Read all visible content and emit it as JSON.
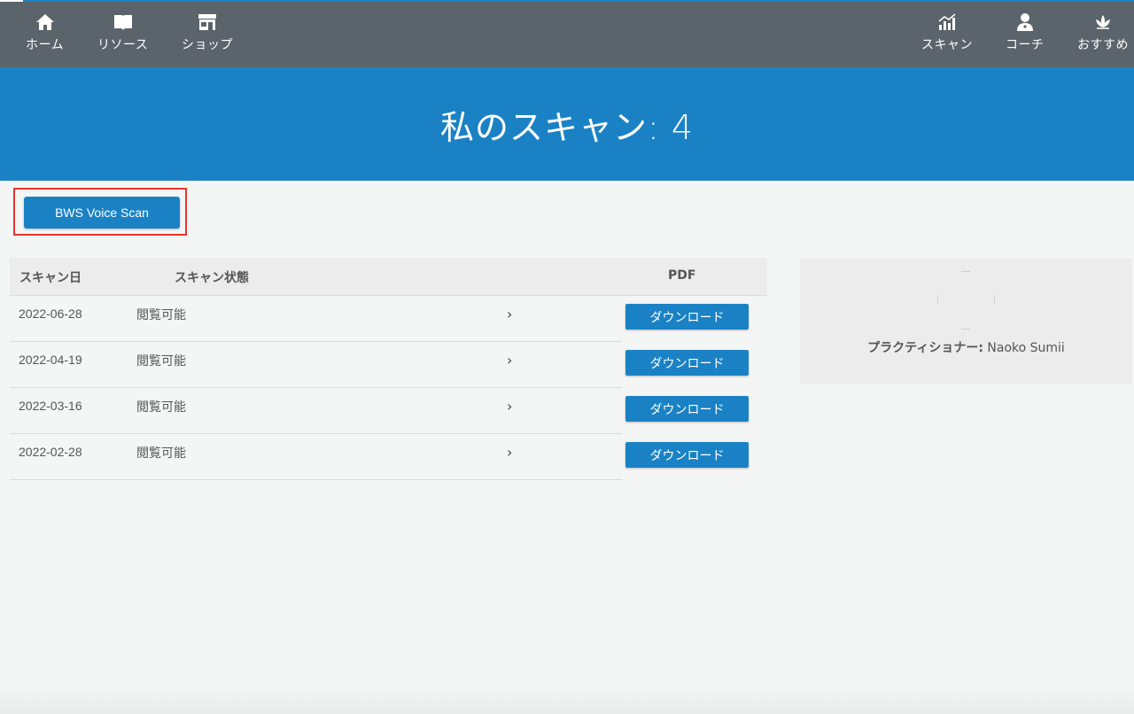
{
  "nav": {
    "left": [
      {
        "label": "ホーム",
        "icon": "home-icon"
      },
      {
        "label": "リソース",
        "icon": "book-icon"
      },
      {
        "label": "ショップ",
        "icon": "store-icon"
      }
    ],
    "right": [
      {
        "label": "スキャン",
        "icon": "chart-icon"
      },
      {
        "label": "コーチ",
        "icon": "coach-icon"
      },
      {
        "label": "おすすめ",
        "icon": "lotus-icon"
      }
    ]
  },
  "banner": {
    "title": "私のスキャン: 4"
  },
  "action": {
    "voice_scan_label": "BWS Voice Scan"
  },
  "table": {
    "headers": {
      "date": "スキャン日",
      "status": "スキャン状態",
      "pdf": "PDF"
    },
    "rows": [
      {
        "date": "2022-06-28",
        "status": "閲覧可能",
        "chevron": "›",
        "download": "ダウンロード"
      },
      {
        "date": "2022-04-19",
        "status": "閲覧可能",
        "chevron": "›",
        "download": "ダウンロード"
      },
      {
        "date": "2022-03-16",
        "status": "閲覧可能",
        "chevron": "›",
        "download": "ダウンロード"
      },
      {
        "date": "2022-02-28",
        "status": "閲覧可能",
        "chevron": "›",
        "download": "ダウンロード"
      }
    ]
  },
  "panel": {
    "practitioner_label": "プラクティショナー:",
    "practitioner_name": "Naoko Sumii"
  },
  "colors": {
    "nav_bg": "#5b646b",
    "accent": "#1a82c4",
    "highlight": "#e8372c",
    "page_bg": "#f4f5f5"
  }
}
